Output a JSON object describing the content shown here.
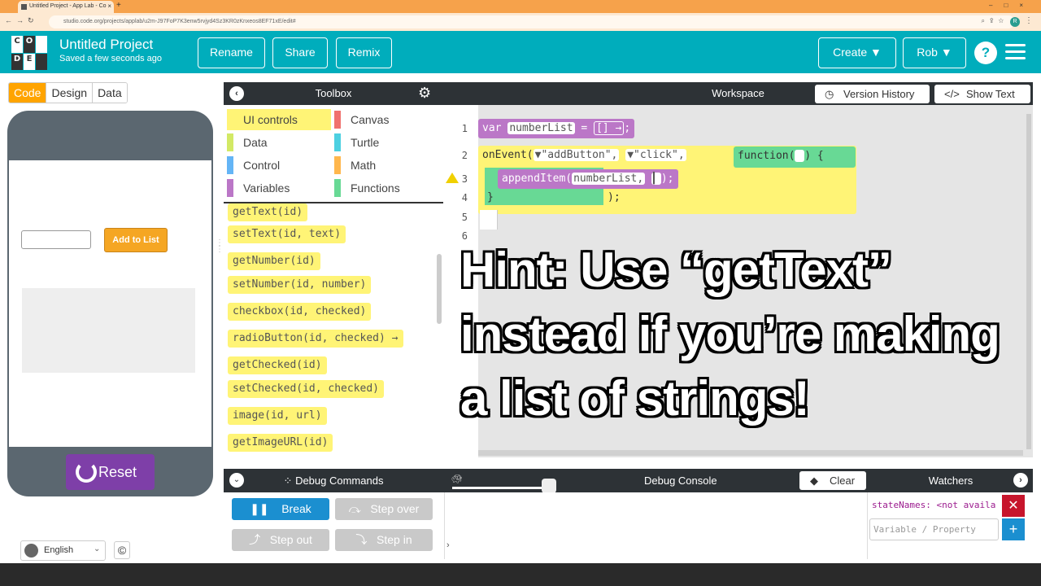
{
  "browser": {
    "tab_title": "Untitled Project - App Lab - Co",
    "url": "studio.code.org/projects/applab/u2m-J97FoP7K3enw5rvjyd4Sz3KR0zKnxeos8EF71xE/edit#",
    "profile_initial": "R"
  },
  "header": {
    "logo_letters": [
      "C",
      "O",
      "D",
      "E"
    ],
    "project_title": "Untitled Project",
    "saved_status": "Saved a few seconds ago",
    "rename_label": "Rename",
    "share_label": "Share",
    "remix_label": "Remix",
    "create_label": "Create",
    "user_label": "Rob",
    "help_label": "?"
  },
  "mode_tabs": [
    "Code",
    "Design",
    "Data"
  ],
  "app_preview": {
    "add_button_label": "Add to List",
    "reset_label": "Reset",
    "language": "English",
    "copyright_symbol": "©"
  },
  "toolbox": {
    "title": "Toolbox",
    "categories": [
      {
        "label": "UI controls",
        "color": "#fff476"
      },
      {
        "label": "Canvas",
        "color": "#f0716e"
      },
      {
        "label": "Data",
        "color": "#d3e965"
      },
      {
        "label": "Turtle",
        "color": "#4dd0e1"
      },
      {
        "label": "Control",
        "color": "#64b5f6"
      },
      {
        "label": "Math",
        "color": "#ffb74d"
      },
      {
        "label": "Variables",
        "color": "#bb77c7"
      },
      {
        "label": "Functions",
        "color": "#68d995"
      }
    ],
    "blocks": [
      "getText(id)",
      "setText(id, text)",
      "getNumber(id)",
      "setNumber(id, number)",
      "checkbox(id, checked)",
      "radioButton(id, checked) →",
      "getChecked(id)",
      "setChecked(id, checked)",
      "image(id, url)",
      "getImageURL(id)"
    ]
  },
  "workspace": {
    "title": "Workspace",
    "version_history_label": "Version History",
    "show_text_label": "Show Text",
    "line_numbers": [
      "1",
      "2",
      "3",
      "4",
      "5",
      "6"
    ],
    "code": {
      "l1_var": "var",
      "l1_name": "numberList",
      "l1_eq": "=",
      "l1_val": "[] →",
      "l1_end": ";",
      "l2_onevent": "onEvent(",
      "l2_id": "▼\"addButton\",",
      "l2_evt": "▼\"click\",",
      "l2_func": "function(",
      "l2_func_end": ") {",
      "l3_append": "appendItem(",
      "l3_arg": "numberList,",
      "l3_end": ");",
      "l4_close": "}",
      "l4_end": ");"
    },
    "hint_overlay": "Hint: Use “getText” instead if you’re making a list of strings!"
  },
  "debug": {
    "commands_title": "Debug Commands",
    "break_label": "Break",
    "step_over_label": "Step over",
    "step_out_label": "Step out",
    "step_in_label": "Step in",
    "console_title": "Debug Console",
    "clear_label": "Clear",
    "console_prompt": "›",
    "watchers_title": "Watchers",
    "watch_item": "stateNames: <not availa",
    "watch_placeholder": "Variable / Property"
  }
}
